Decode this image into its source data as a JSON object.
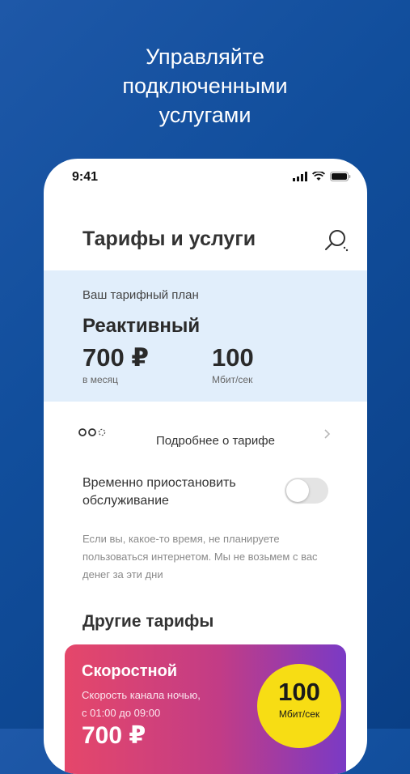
{
  "headline": {
    "lines": [
      "Управляйте",
      "подключенными",
      "услугами"
    ]
  },
  "status_bar": {
    "time": "9:41",
    "icons": [
      "signal-icon",
      "wifi-icon",
      "battery-icon"
    ]
  },
  "header": {
    "title": "Тарифы и услуги",
    "search_icon": "search-icon"
  },
  "current_plan": {
    "label": "Ваш тарифный план",
    "name": "Реактивный",
    "price": "700 ₽",
    "price_unit": "в месяц",
    "speed": "100",
    "speed_unit": "Мбит/сек"
  },
  "details": {
    "label": "Подробнее о тарифе",
    "icon": "dots-loading-icon"
  },
  "suspend": {
    "label": "Временно приостановить обслуживание",
    "toggle_on": false,
    "note": "Если вы, какое-то время, не планируете пользоваться интернетом. Мы не возьмем с вас денег за эти дни"
  },
  "other_tariffs": {
    "title": "Другие тарифы",
    "card": {
      "name": "Скоростной",
      "desc_line1": "Скорость канала ночью,",
      "desc_line2": "с 01:00 до 09:00",
      "badge_value": "100",
      "badge_unit": "Мбит/сек",
      "partial_price": "700 ₽"
    }
  },
  "colors": {
    "background": "#114e9c",
    "plan_card": "#e1eefb",
    "badge": "#f7dd14",
    "promo_start": "#e5476a",
    "promo_end": "#7a3ac5"
  }
}
